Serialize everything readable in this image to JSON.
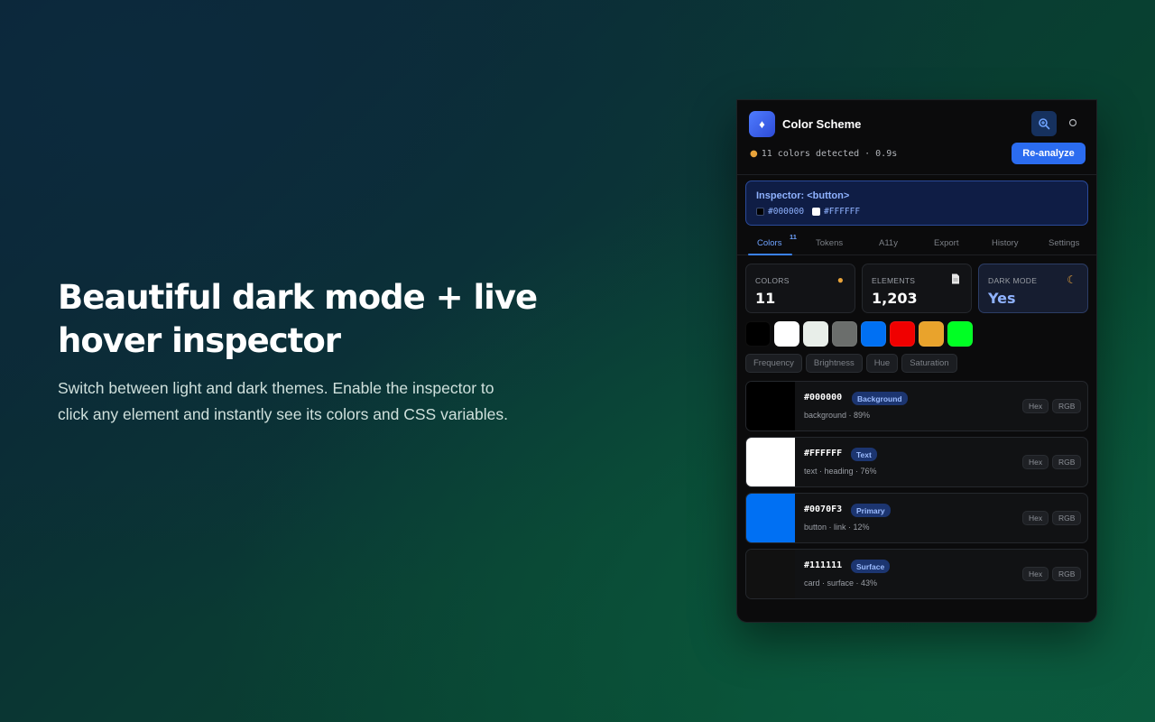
{
  "hero": {
    "title_line1": "Beautiful dark mode + live",
    "title_line2": "hover inspector",
    "desc_line1": "Switch between light and dark themes. Enable the inspector to",
    "desc_line2": "click any element and instantly see its colors and CSS variables."
  },
  "panel": {
    "title": "Color Scheme",
    "status": "11 colors detected · 0.9s",
    "reanalyze_label": "Re-analyze",
    "icons": {
      "logo": "palette-logo-icon",
      "inspect": "inspect-icon",
      "theme": "theme-toggle-icon",
      "status": "palette-icon"
    },
    "inspector": {
      "title": "Inspector: <button>",
      "colors": [
        {
          "hex": "#000000",
          "color": "#000000"
        },
        {
          "hex": "#FFFFFF",
          "color": "#FFFFFF"
        }
      ]
    },
    "tabs": [
      {
        "label": "Colors",
        "badge": "11",
        "active": true
      },
      {
        "label": "Tokens"
      },
      {
        "label": "A11y"
      },
      {
        "label": "Export"
      },
      {
        "label": "History"
      },
      {
        "label": "Settings"
      }
    ],
    "stats": [
      {
        "label": "COLORS",
        "value": "11",
        "icon": "palette-icon"
      },
      {
        "label": "ELEMENTS",
        "value": "1,203",
        "icon": "document-icon"
      },
      {
        "label": "DARK MODE",
        "value": "Yes",
        "icon": "moon-icon"
      }
    ],
    "swatches": [
      "#000000",
      "#FFFFFF",
      "#E8EEE9",
      "#6B6E6C",
      "#0070F3",
      "#F00000",
      "#E9A32C",
      "#00FF24"
    ],
    "sort_chips": [
      "Frequency",
      "Brightness",
      "Hue",
      "Saturation"
    ],
    "colors": [
      {
        "hex": "#000000",
        "tag": "Background",
        "meta": "background  · 89%",
        "swatch": "#000000"
      },
      {
        "hex": "#FFFFFF",
        "tag": "Text",
        "meta": "text · heading  · 76%",
        "swatch": "#FFFFFF"
      },
      {
        "hex": "#0070F3",
        "tag": "Primary",
        "meta": "button · link  · 12%",
        "swatch": "#0070F3"
      },
      {
        "hex": "#111111",
        "tag": "Surface",
        "meta": "card · surface  · 43%",
        "swatch": "#111111"
      }
    ],
    "format_buttons": [
      "Hex",
      "RGB"
    ],
    "accent": "#2B6CF0"
  }
}
